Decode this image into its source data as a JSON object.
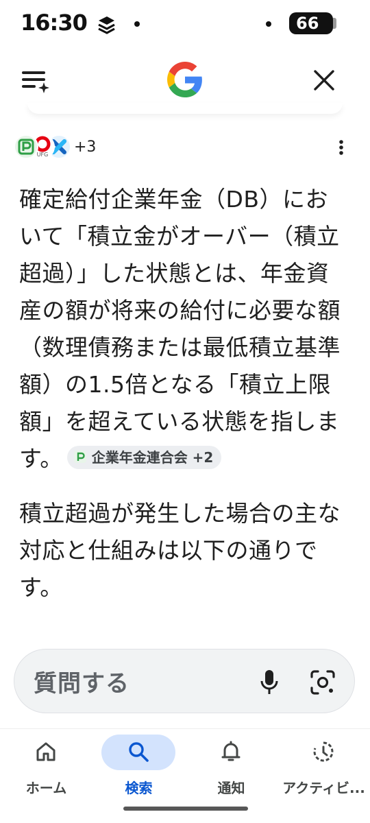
{
  "status_bar": {
    "time": "16:30",
    "battery": "66"
  },
  "header": {
    "menu_icon": "menu-sparkle-icon",
    "logo": "google-g-logo",
    "close_icon": "close-icon"
  },
  "sources": {
    "more_count": "+3",
    "favicon_texts": [
      "UFG"
    ]
  },
  "answer": {
    "paragraph1": "確定給付企業年金（DB）において「積立金がオーバー（積立超過）」した状態とは、年金資産の額が将来の給付に必要な額（数理債務または最低積立基準額）の1.5倍となる「積立上限額」を超えている状態を指します。",
    "citation_label": "企業年金連合会 +2",
    "paragraph2": "積立超過が発生した場合の主な対応と仕組みは以下の通りです。"
  },
  "ask_bar": {
    "placeholder": "質問する"
  },
  "bottom_nav": {
    "items": [
      {
        "label": "ホーム",
        "icon": "home-icon",
        "active": false
      },
      {
        "label": "検索",
        "icon": "search-icon",
        "active": true
      },
      {
        "label": "通知",
        "icon": "bell-icon",
        "active": false
      },
      {
        "label": "アクティビ...",
        "icon": "activity-icon",
        "active": false
      }
    ]
  },
  "colors": {
    "accent": "#0b57d0",
    "active_pill": "#d3e3fd",
    "google_blue": "#4285F4",
    "google_red": "#EA4335",
    "google_yellow": "#FBBC05",
    "google_green": "#34A853"
  }
}
